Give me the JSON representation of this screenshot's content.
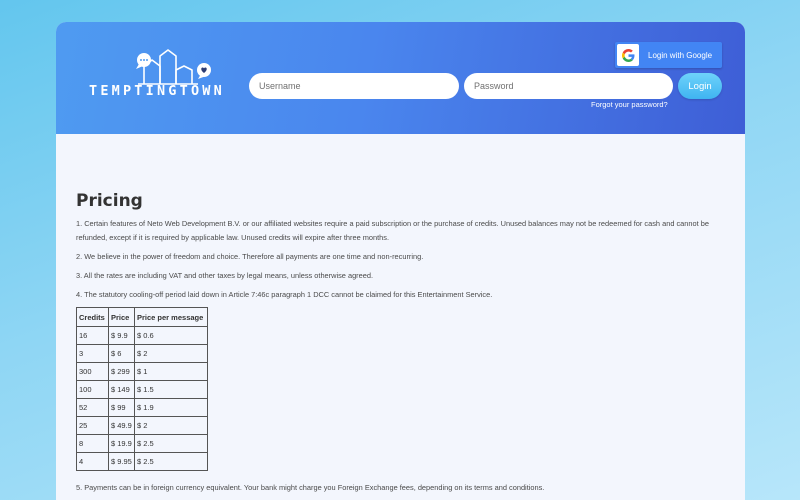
{
  "brand": {
    "name": "TEMPTINGTOWN"
  },
  "login": {
    "google_label": "Login with Google",
    "username_placeholder": "Username",
    "password_placeholder": "Password",
    "login_label": "Login",
    "forgot_label": "Forgot your password?"
  },
  "page": {
    "title": "Pricing",
    "paragraphs": [
      "1. Certain features of Neto Web Development B.V. or our affiliated websites require a paid subscription or the purchase of credits. Unused balances may not be redeemed for cash and cannot be refunded, except if it is required by applicable law. Unused credits will expire after three months.",
      "2. We believe in the power of freedom and choice. Therefore all payments are one time and non-recurring.",
      "3. All the rates are including VAT and other taxes by legal means, unless otherwise agreed.",
      "4. The statutory cooling-off period laid down in Article 7:46c paragraph 1 DCC cannot be claimed for this Entertainment Service."
    ],
    "after_table": "5. Payments can be in foreign currency equivalent. Your bank might charge you Foreign Exchange fees, depending on its terms and conditions."
  },
  "table": {
    "headers": [
      "Credits",
      "Price",
      "Price per message"
    ],
    "rows": [
      [
        "16",
        "$ 9.9",
        "$ 0.6"
      ],
      [
        "3",
        "$ 6",
        "$ 2"
      ],
      [
        "300",
        "$ 299",
        "$ 1"
      ],
      [
        "100",
        "$ 149",
        "$ 1.5"
      ],
      [
        "52",
        "$ 99",
        "$ 1.9"
      ],
      [
        "25",
        "$ 49.9",
        "$ 2"
      ],
      [
        "8",
        "$ 19.9",
        "$ 2.5"
      ],
      [
        "4",
        "$ 9.95",
        "$ 2.5"
      ]
    ]
  },
  "colors": {
    "header_start": "#4f9bf1",
    "header_end": "#3e5ed6",
    "google_blue": "#4285f4",
    "login_button": "#3fb4f1"
  },
  "icons": [
    "town-logo-icon",
    "chat-bubble-icon",
    "heart-bubble-icon",
    "google-g-icon"
  ]
}
